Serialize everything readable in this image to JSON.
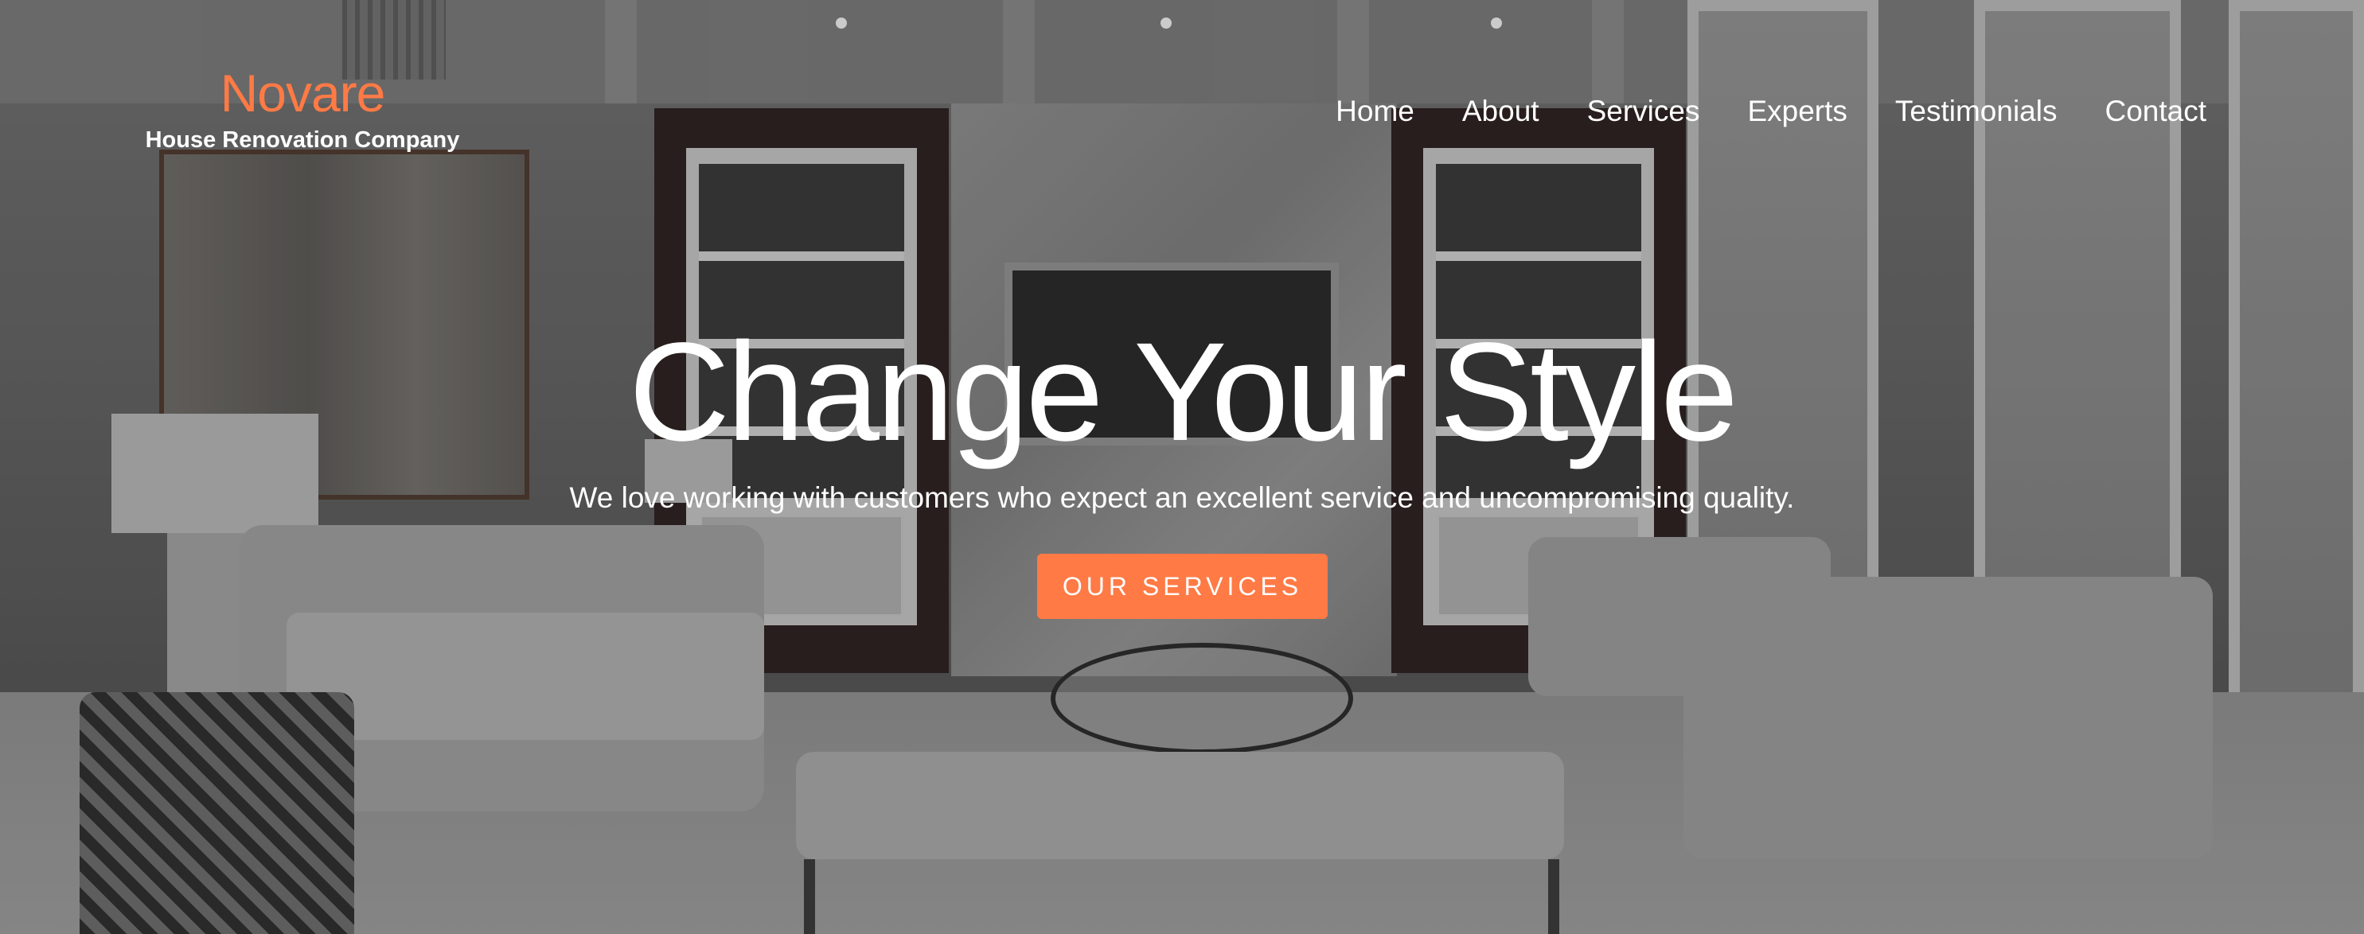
{
  "header": {
    "brand_name": "Novare",
    "brand_tagline": "House Renovation Company"
  },
  "nav": {
    "items": [
      {
        "label": "Home"
      },
      {
        "label": "About"
      },
      {
        "label": "Services"
      },
      {
        "label": "Experts"
      },
      {
        "label": "Testimonials"
      },
      {
        "label": "Contact"
      }
    ]
  },
  "hero": {
    "title": "Change Your Style",
    "subtitle": "We love working with customers who expect an excellent service and uncompromising quality.",
    "cta_label": "OUR SERVICES",
    "background_image": "living-room-interior"
  },
  "colors": {
    "accent": "#ff7a45",
    "text": "#ffffff"
  }
}
